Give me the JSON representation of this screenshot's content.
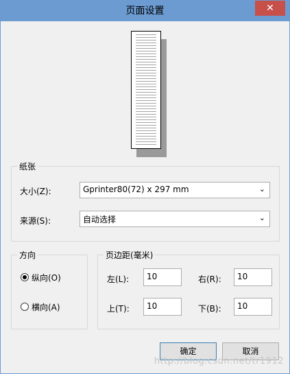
{
  "window": {
    "title": "页面设置",
    "close": "✕"
  },
  "paper": {
    "group_label": "纸张",
    "size_label": "大小(Z):",
    "size_value": "Gprinter80(72) x 297 mm",
    "source_label": "来源(S):",
    "source_value": "自动选择",
    "dropdown_glyph": "⌄"
  },
  "orientation": {
    "group_label": "方向",
    "portrait_label": "纵向(O)",
    "landscape_label": "横向(A)",
    "selected": "portrait"
  },
  "margins": {
    "group_label": "页边距(毫米)",
    "left_label": "左(L):",
    "left_value": "10",
    "right_label": "右(R):",
    "right_value": "10",
    "top_label": "上(T):",
    "top_value": "10",
    "bottom_label": "下(B):",
    "bottom_value": "10"
  },
  "buttons": {
    "ok": "确定",
    "cancel": "取消"
  },
  "watermark": "http://blog.csdn.net/tr1912",
  "colors": {
    "titlebar": "#6b9bd1",
    "close_button": "#c7504b",
    "background": "#f0f0f0"
  }
}
